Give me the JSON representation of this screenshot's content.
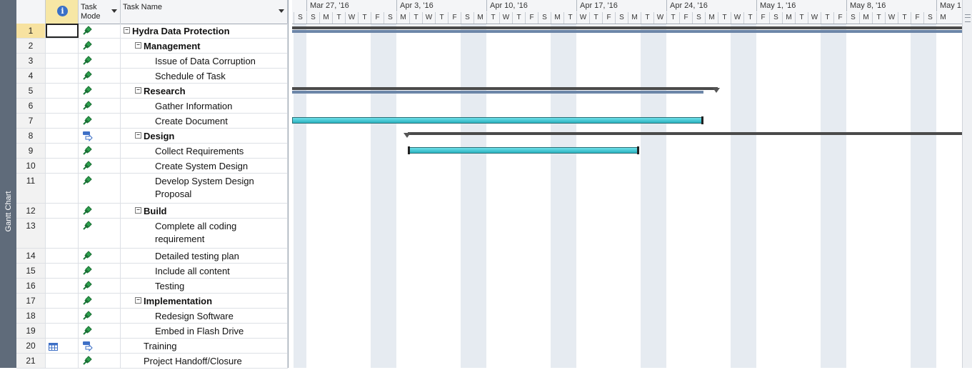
{
  "side_tab": "Gantt Chart",
  "columns": {
    "info": "i",
    "mode": "Task\nMode",
    "mode_l1": "Task",
    "mode_l2": "Mode",
    "name": "Task Name"
  },
  "tasks": [
    {
      "id": "1",
      "name": "Hydra Data Protection",
      "level": 0,
      "bold": true,
      "mode": "manual"
    },
    {
      "id": "2",
      "name": "Management",
      "level": 1,
      "bold": true,
      "mode": "manual"
    },
    {
      "id": "3",
      "name": "Issue of Data Corruption",
      "level": 2,
      "mode": "manual"
    },
    {
      "id": "4",
      "name": "Schedule of Task",
      "level": 2,
      "mode": "manual"
    },
    {
      "id": "5",
      "name": "Research",
      "level": 1,
      "bold": true,
      "mode": "manual"
    },
    {
      "id": "6",
      "name": "Gather Information",
      "level": 2,
      "mode": "manual"
    },
    {
      "id": "7",
      "name": "Create Document",
      "level": 2,
      "mode": "manual"
    },
    {
      "id": "8",
      "name": "Design",
      "level": 1,
      "bold": true,
      "mode": "auto"
    },
    {
      "id": "9",
      "name": "Collect Requirements",
      "level": 2,
      "mode": "manual"
    },
    {
      "id": "10",
      "name": "Create System Design",
      "level": 2,
      "mode": "manual"
    },
    {
      "id": "11",
      "name": "Develop System Design",
      "name2": "Proposal",
      "level": 2,
      "mode": "manual"
    },
    {
      "id": "12",
      "name": "Build",
      "level": 1,
      "bold": true,
      "mode": "manual"
    },
    {
      "id": "13",
      "name": "Complete all coding",
      "name2": "requirement",
      "level": 2,
      "mode": "manual"
    },
    {
      "id": "14",
      "name": "Detailed testing plan",
      "level": 2,
      "mode": "manual"
    },
    {
      "id": "15",
      "name": "Include all content",
      "level": 2,
      "mode": "manual"
    },
    {
      "id": "16",
      "name": "Testing",
      "level": 2,
      "mode": "manual"
    },
    {
      "id": "17",
      "name": "Implementation",
      "level": 1,
      "bold": true,
      "mode": "manual"
    },
    {
      "id": "18",
      "name": "Redesign Software",
      "level": 2,
      "mode": "manual"
    },
    {
      "id": "19",
      "name": "Embed in Flash Drive",
      "level": 2,
      "mode": "manual"
    },
    {
      "id": "20",
      "name": "Training",
      "level": 1,
      "mode": "auto",
      "info": "calendar"
    },
    {
      "id": "21",
      "name": "Project Handoff/Closure",
      "level": 1,
      "mode": "manual"
    }
  ],
  "timescale": {
    "weeks": [
      "Mar 27, '16",
      "Apr 3, '16",
      "Apr 10, '16",
      "Apr 17, '16",
      "Apr 24, '16",
      "May 1, '16",
      "May 8, '16",
      "May 1"
    ],
    "days": [
      "S",
      "S",
      "M",
      "T",
      "W",
      "T",
      "F",
      "S",
      "M",
      "T",
      "W",
      "T",
      "F",
      "S",
      "M",
      "T",
      "W",
      "T",
      "F",
      "S",
      "M",
      "T",
      "W",
      "T",
      "F",
      "S",
      "M",
      "T",
      "W",
      "T",
      "F",
      "S",
      "M",
      "T",
      "W",
      "T",
      "F",
      "S",
      "M",
      "T",
      "W",
      "T",
      "F",
      "S",
      "M",
      "T",
      "W",
      "T",
      "F",
      "S",
      "M"
    ]
  },
  "colors": {
    "task_bar": "#2bb3c0",
    "summary_bar": "#4a4a4a",
    "progress_bar": "#6c86a8",
    "selected_row": "#f7e2a0"
  }
}
